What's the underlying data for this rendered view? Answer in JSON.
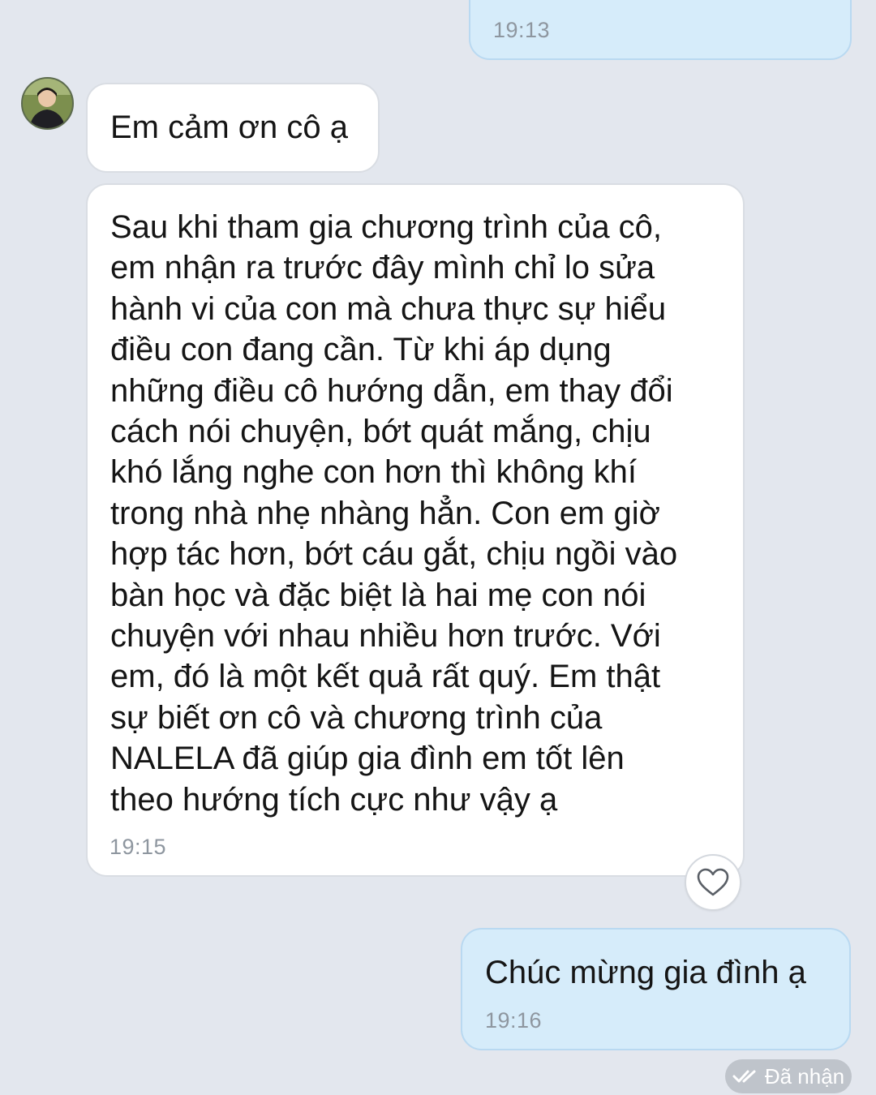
{
  "messages": [
    {
      "direction": "out",
      "text": "",
      "time": "19:13"
    },
    {
      "direction": "in",
      "text": "Em cảm ơn cô ạ",
      "time": ""
    },
    {
      "direction": "in",
      "text": "Sau khi tham gia chương trình của cô,\nem nhận ra trước đây mình chỉ lo sửa\nhành vi của con mà chưa thực sự hiểu\nđiều con đang cần. Từ khi áp dụng\nnhững điều cô hướng dẫn, em thay đổi\ncách nói chuyện, bớt quát mắng, chịu\nkhó lắng nghe con hơn thì không khí\ntrong nhà nhẹ nhàng hẳn. Con em giờ\nhợp tác hơn, bớt cáu gắt, chịu ngồi vào\nbàn học và đặc biệt là hai mẹ con nói\nchuyện với nhau nhiều hơn trước. Với\nem, đó là một kết quả rất quý. Em thật\nsự biết ơn cô và chương trình của\nNALELA đã giúp gia đình em tốt lên\ntheo hướng tích cực như vậy ạ",
      "time": "19:15"
    },
    {
      "direction": "out",
      "text": "Chúc mừng gia đình ạ",
      "time": "19:16"
    }
  ],
  "status": {
    "label": "Đã nhận",
    "icon": "double-check-icon"
  },
  "icons": {
    "reaction": "heart-icon",
    "avatar": "contact-avatar"
  },
  "colors": {
    "background": "#e3e7ee",
    "outgoing_bubble": "#d6ecfa",
    "incoming_bubble": "#ffffff",
    "timestamp": "#8e969f",
    "status_pill": "#bfc4cb"
  }
}
